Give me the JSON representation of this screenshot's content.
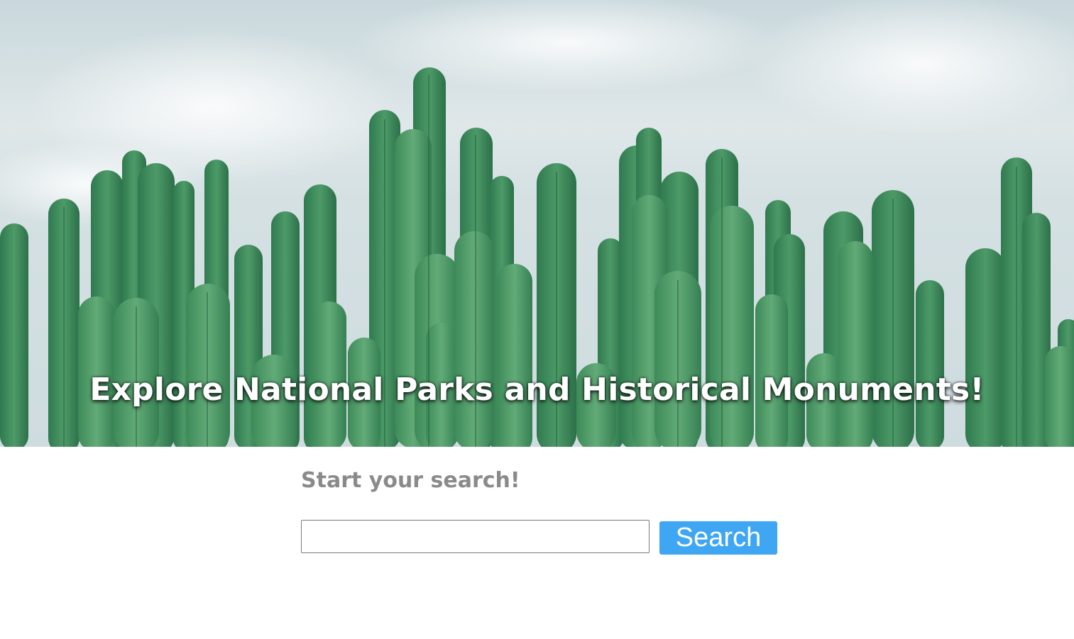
{
  "hero": {
    "title": "Explore National Parks and Historical Monuments!",
    "image_description_icon": "cactus-photo"
  },
  "search": {
    "heading": "Start your search!",
    "input_value": "",
    "input_placeholder": "",
    "button_label": "Search"
  },
  "colors": {
    "button_bg": "#3ea6f2",
    "heading_text": "#8a8a8a",
    "hero_text": "#ffffff"
  }
}
